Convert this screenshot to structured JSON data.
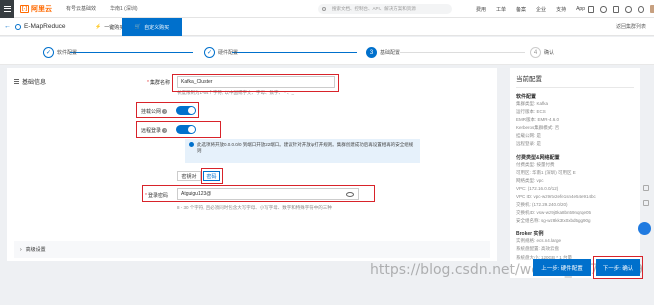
{
  "topbar": {
    "logo": "阿里云",
    "menu": [
      "有号云基础效",
      "华南1 (深圳)"
    ],
    "search_placeholder": "搜索文档、控制台、API、解决方案和资源",
    "links": [
      "费用",
      "工单",
      "备案",
      "企业",
      "支持",
      "App"
    ],
    "user": "国内"
  },
  "appbar": {
    "title": "E-MapReduce",
    "tabs": [
      "一键购买",
      "自定义购买"
    ],
    "return_link": "返回集群列表"
  },
  "steps": [
    {
      "num": "✓",
      "label": "软件配置"
    },
    {
      "num": "✓",
      "label": "硬件配置"
    },
    {
      "num": "3",
      "label": "基础配置"
    },
    {
      "num": "4",
      "label": "确认"
    }
  ],
  "form": {
    "section_title": "基础信息",
    "cluster_name_label": "集群名称",
    "cluster_name_value": "Kafka_Cluster",
    "cluster_name_hint": "长度限制为1-64个字符, 以中国或字文、字母、数字、 - 、_",
    "public_label": "挂载公网",
    "ssh_label": "远程登录",
    "notice": "此选项将开放0.0.0.0/0 到端口开放22端口。建议针对开放ip打开规则。集群创建成功后再设置相再的安全组规则",
    "auth_options": [
      "密钥对",
      "密码"
    ],
    "password_label": "登录密码",
    "password_value": "Atguigu123@",
    "password_hint": "8 - 30 个字符, 且必须同时包含大写字母、小写字母、数字和特殊字符中的三种",
    "advanced_label": "高级设置"
  },
  "summary": {
    "title": "当前配置",
    "software_head": "软件配置",
    "software_rows": [
      "集群类型: Kafka",
      "运行版本: ECS",
      "EMR版本: EMR-4.6.0",
      "Kerberos集群模式: 否",
      "挂载公网: 是",
      "远程登录: 是"
    ],
    "hardware_head": "付费类型&网络配置",
    "hardware_rows": [
      "付费类型: 按量付费",
      "可用区: 华南1 (深圳) 可用区 E",
      "网络类型: vpc",
      "VPC: (172.16.0.0/12)",
      "VPC ID: vpc-wz9rtv2efe1sn4e54e914bc",
      "交换机: (172.29.240.0/20)",
      "交换机ID: vsw-wz9j0ka8bn59nqrqe05",
      "安全组名称: sg-wz8kk3tx0xbd5gg90g"
    ],
    "broker_head": "Broker 实例",
    "broker_rows": [
      "实例规格: ecs.n4.large",
      "系统盘配置: 高效云盘",
      "系统盘大小: 120GB * 1 台量"
    ]
  },
  "footer": {
    "prev": "上一步: 硬件配置",
    "next": "下一步: 确认",
    "watermark": "https://blog.csdn.net/weixin_42703659"
  }
}
